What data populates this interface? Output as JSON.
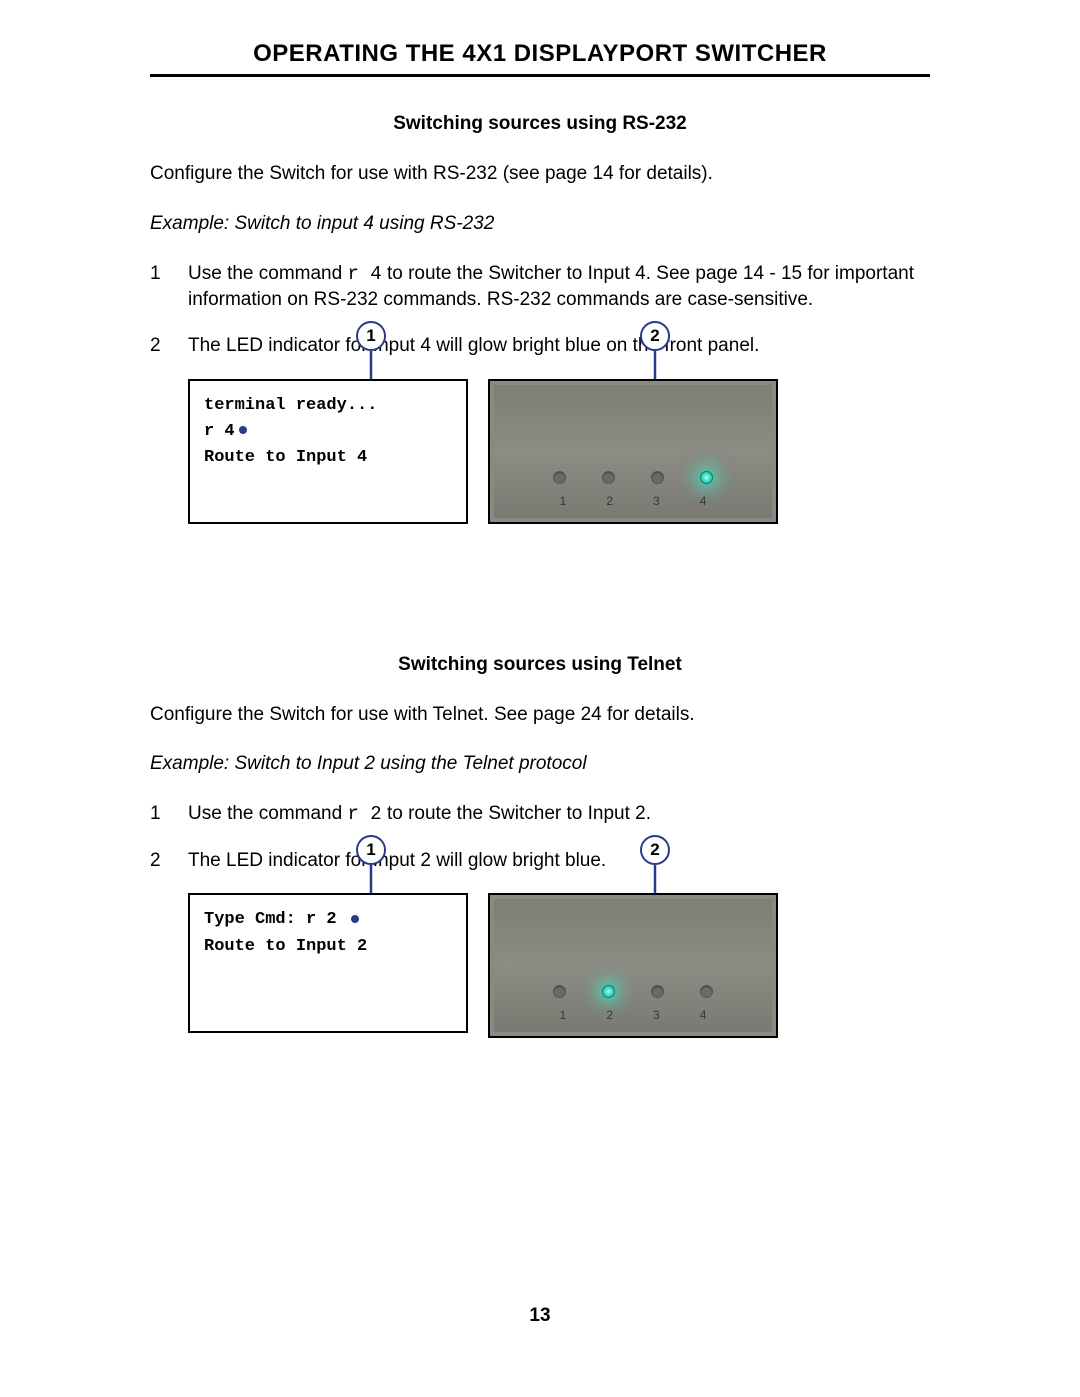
{
  "title": "OPERATING THE 4X1 DISPLAYPORT SWITCHER",
  "page_number": "13",
  "section1": {
    "heading": "Switching sources using RS-232",
    "intro": "Configure the Switch for use with RS-232 (see page 14 for details).",
    "example": "Example: Switch to input 4 using RS-232",
    "step1_no": "1",
    "step1_pre": "Use the command ",
    "step1_cmd": "r 4",
    "step1_post": " to route the Switcher to Input 4.  See page 14 - 15 for important information on RS-232 commands.  RS-232 commands are case-sensitive.",
    "step2_no": "2",
    "step2": "The LED indicator for Input 4 will glow bright blue on the front panel.",
    "callout1": "1",
    "callout2": "2",
    "term_line1": "terminal ready...",
    "term_line2": "r 4",
    "term_line3": "Route to Input 4",
    "leds": {
      "l1": "1",
      "l2": "2",
      "l3": "3",
      "l4": "4"
    },
    "lit_index": 4
  },
  "section2": {
    "heading": "Switching sources using Telnet",
    "intro": "Configure the Switch for use with Telnet.  See page 24 for details.",
    "example": "Example: Switch to Input 2 using the Telnet protocol",
    "step1_no": "1",
    "step1_pre": "Use the command ",
    "step1_cmd": "r 2",
    "step1_post": " to route the Switcher to Input 2.",
    "step2_no": "2",
    "step2": "The LED indicator for Input 2 will glow bright blue.",
    "callout1": "1",
    "callout2": "2",
    "term_line1": "Type Cmd: r 2",
    "term_line2": "",
    "term_line3": "Route to Input 2",
    "leds": {
      "l1": "1",
      "l2": "2",
      "l3": "3",
      "l4": "4"
    },
    "lit_index": 2
  }
}
